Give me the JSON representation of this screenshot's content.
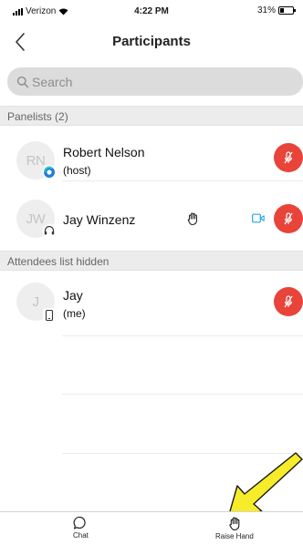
{
  "status_bar": {
    "carrier": "Verizon",
    "time": "4:22 PM",
    "battery": "31%",
    "battery_level": 0.31
  },
  "header": {
    "title": "Participants",
    "back_icon": "chevron-left-icon"
  },
  "search": {
    "placeholder": "Search",
    "icon": "search-icon"
  },
  "panelists": {
    "header": "Panelists (2)",
    "items": [
      {
        "initials": "RN",
        "name": "Robert Nelson",
        "role": "(host)",
        "badge_icon": "host-badge-icon",
        "mic_icon": "mic-muted-icon"
      },
      {
        "initials": "JW",
        "name": "Jay Winzenz",
        "badge_icon": "headset-icon",
        "hand_icon": "raised-hand-icon",
        "video_icon": "video-icon",
        "mic_icon": "mic-muted-icon"
      }
    ]
  },
  "attendees": {
    "header": "Attendees list hidden",
    "items": [
      {
        "initials": "J",
        "name": "Jay",
        "role": "(me)",
        "badge_icon": "mobile-phone-icon",
        "mic_icon": "mic-muted-icon"
      }
    ]
  },
  "tab_bar": {
    "chat_label": "Chat",
    "raise_hand_label": "Raise Hand"
  },
  "colors": {
    "mic_muted": "#e8443a",
    "video_icon": "#2aa6df",
    "host_badge": "#1f7fd6",
    "annotation_arrow": "#f6ec2a"
  }
}
